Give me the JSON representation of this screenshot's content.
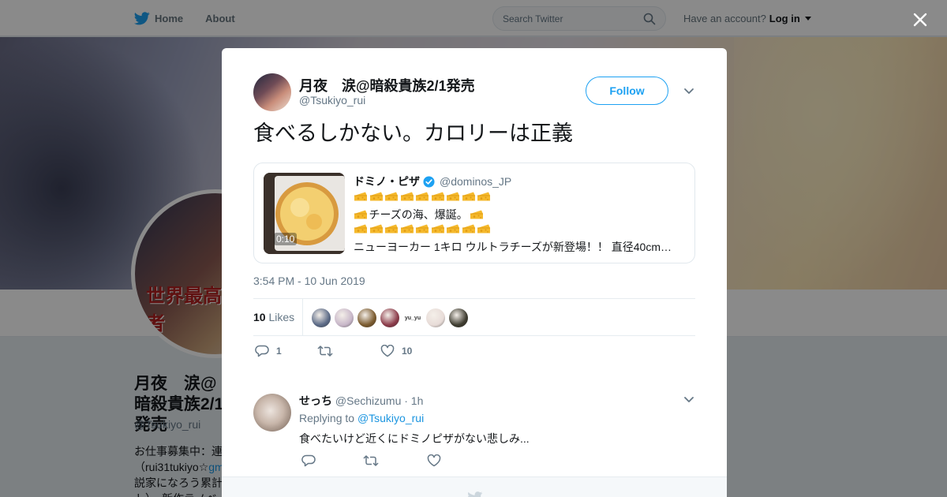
{
  "nav": {
    "home_label": "Home",
    "about_label": "About",
    "search_placeholder": "Search Twitter",
    "account_prompt": "Have an account?",
    "login_label": "Log in"
  },
  "profile": {
    "name": "月夜　涙@暗殺貴族2/1発売",
    "handle": "@Tsukiyo_rui",
    "bio_line1": "お仕事募集中：連",
    "bio_line2_prefix": "（rui31tukiyo☆",
    "bio_line2_link": "gm",
    "bio_line3": "説家になろう累計",
    "bio_line4": "ト）、新作ラノベ",
    "avatar_title": "世界最高の暗殺者"
  },
  "tweet": {
    "author_name": "月夜　涙@暗殺貴族2/1発売",
    "author_handle": "@Tsukiyo_rui",
    "follow_label": "Follow",
    "text": "食べるしかない。カロリーは正義",
    "timestamp": "3:54 PM - 10 Jun 2019",
    "likes_count": "10",
    "likes_label": "Likes",
    "reply_count": "1",
    "retweet_count": "",
    "like_count": "10",
    "liker_colors": [
      "#5b6a86",
      "#c8b7c9",
      "#7a5a2e",
      "#8c3b4a",
      "#f0f0f0",
      "#e8dcd8",
      "#3d3b2f"
    ],
    "liker_text_5": "yu_yu"
  },
  "quote": {
    "name": "ドミノ・ピザ",
    "handle": "@dominos_JP",
    "video_duration": "0:10",
    "cheese_row_count": 9,
    "line2_text": "チーズの海、爆誕。",
    "line4_text": "ニューヨーカー 1キロ ウルトラチーズが新登場！！ 直径40cm…",
    "verified": true
  },
  "reply": {
    "name": "せっち",
    "handle": "@Sechizumu",
    "time": "· 1h",
    "replying_prefix": "Replying to",
    "replying_to": "@Tsukiyo_rui",
    "text": "食べたいけど近くにドミノピザがない悲しみ..."
  },
  "colors": {
    "accent": "#1da1f2",
    "link": "#1b95e0",
    "text_primary": "#14171a",
    "text_secondary": "#657786",
    "cheese": "#f5b92c"
  }
}
